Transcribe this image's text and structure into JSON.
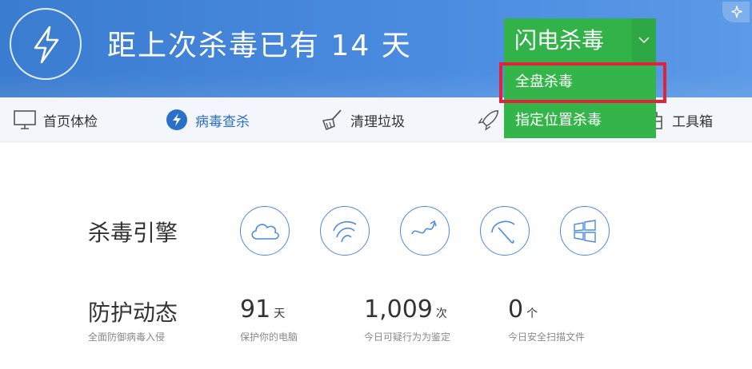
{
  "header": {
    "headline": "距上次杀毒已有 14 天",
    "bolt_icon": "lightning-icon",
    "sparkle_icon": "sparkle-icon",
    "colors": {
      "background": "#4a8be0",
      "scan_button": "#32b34a",
      "highlight": "#e0223a"
    }
  },
  "scan": {
    "button_label": "闪电杀毒",
    "caret_icon": "chevron-down-icon",
    "menu": [
      {
        "label": "全盘杀毒"
      },
      {
        "label": "指定位置杀毒"
      }
    ]
  },
  "nav": {
    "items": [
      {
        "label": "首页体检",
        "icon": "monitor-icon"
      },
      {
        "label": "病毒查杀",
        "icon": "lightning-icon"
      },
      {
        "label": "清理垃圾",
        "icon": "broom-icon"
      },
      {
        "label": "工具箱",
        "icon": "toolbox-icon"
      }
    ],
    "partial_icon": "rocket-icon"
  },
  "engine": {
    "title": "杀毒引擎",
    "icons": [
      "cloud-icon",
      "engine-swirl-icon",
      "behavior-arrow-icon",
      "umbrella-icon",
      "windows-icon"
    ]
  },
  "protection": {
    "title": "防护动态",
    "subtitle": "全面防御病毒入侵",
    "stats": [
      {
        "value": "91",
        "unit": "天",
        "label": "保护你的电脑"
      },
      {
        "value": "1,009",
        "unit": "次",
        "label": "今日可疑行为为鉴定"
      },
      {
        "value": "0",
        "unit": "个",
        "label": "今日安全扫描文件"
      }
    ]
  }
}
